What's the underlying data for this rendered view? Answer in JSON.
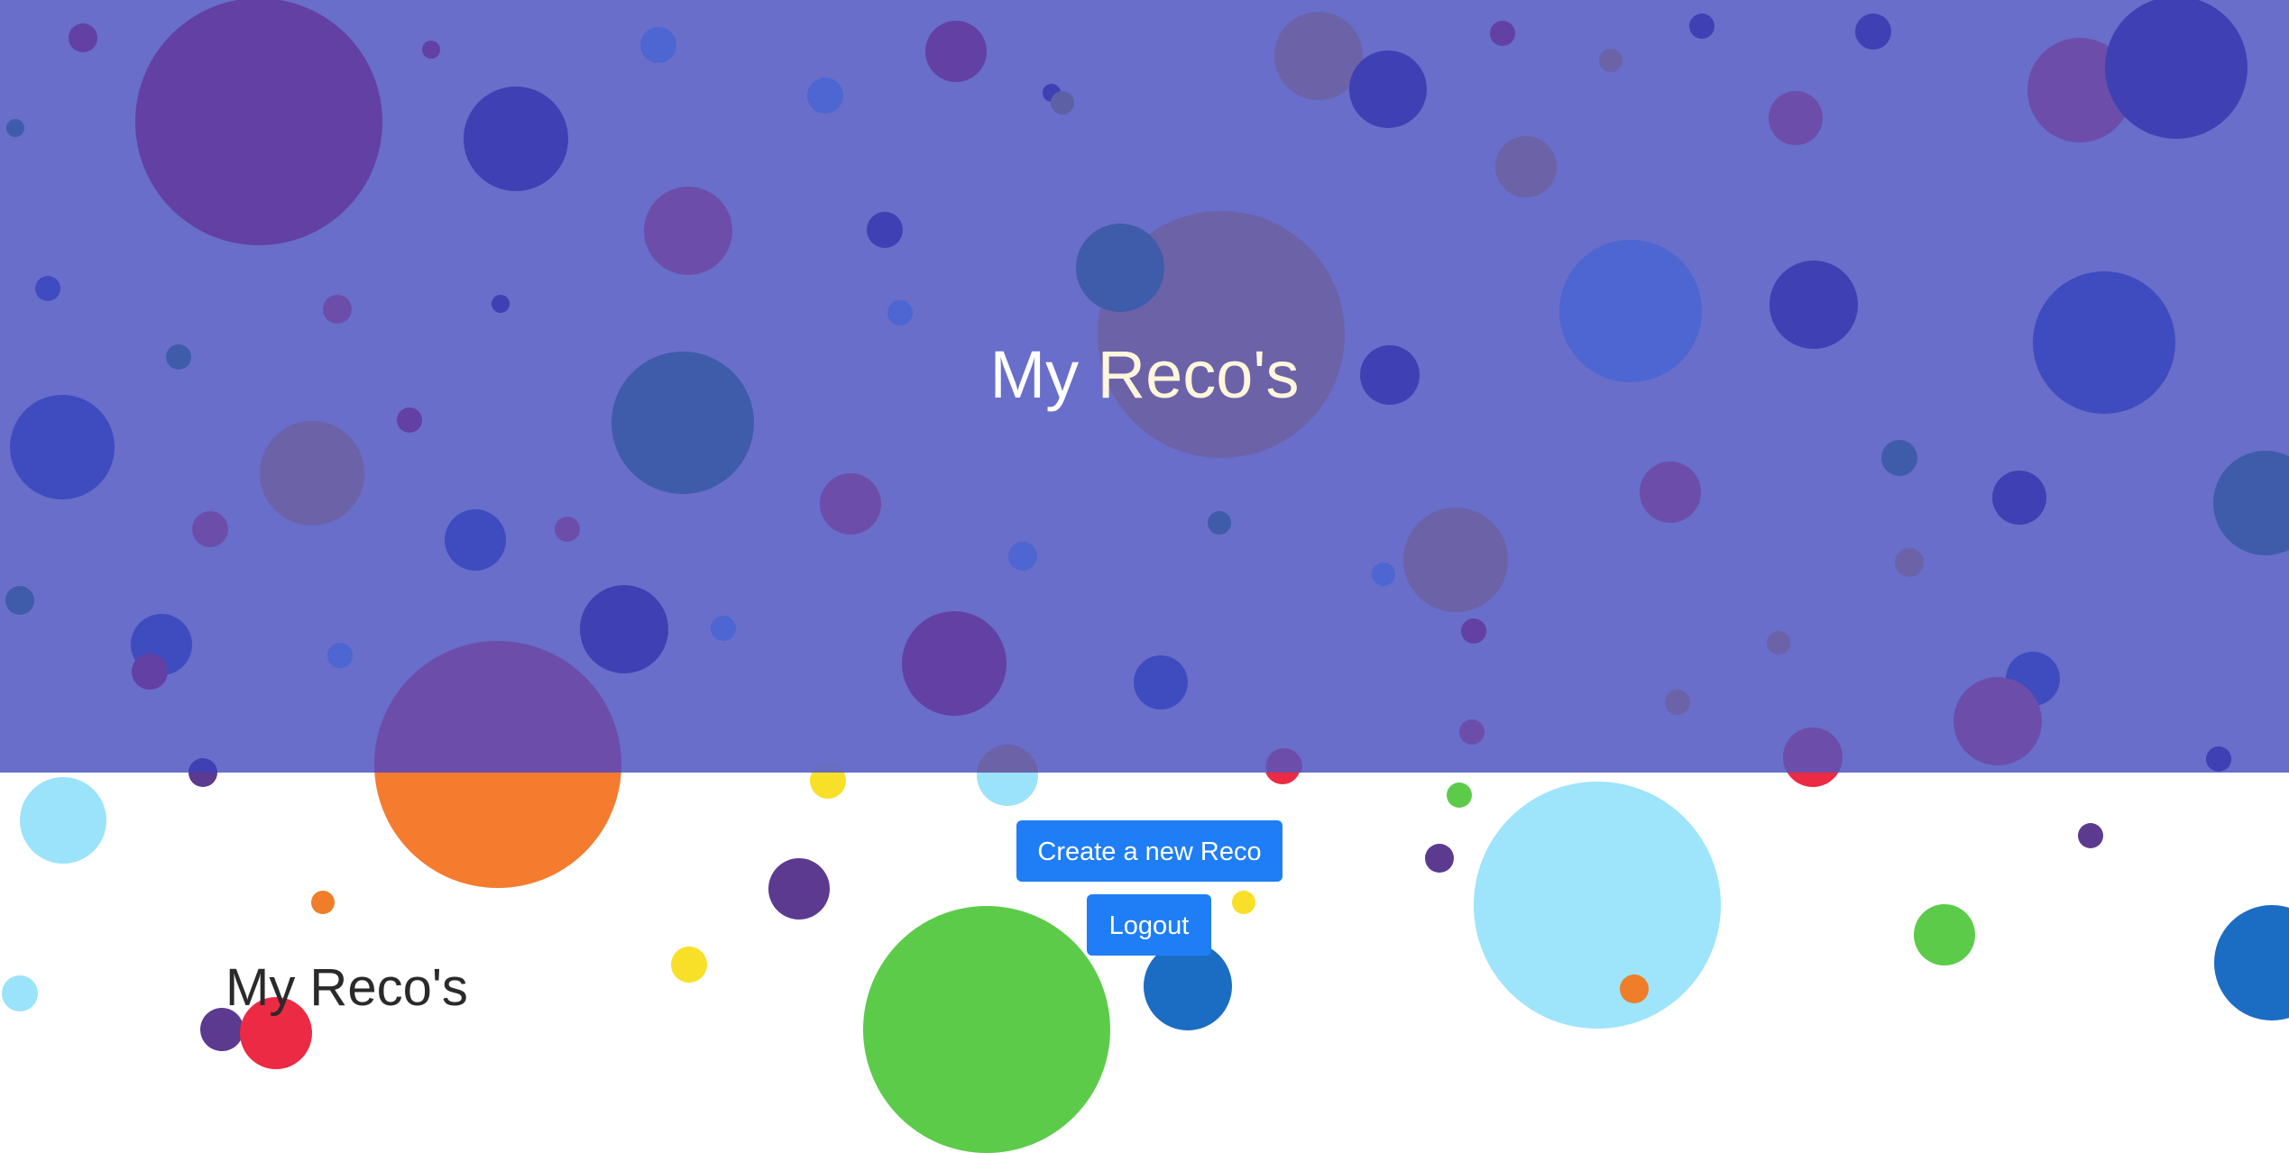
{
  "hero": {
    "title_part1": "My",
    "title_part2": "Reco's"
  },
  "actions": {
    "create_label": "Create a new Reco",
    "logout_label": "Logout"
  },
  "section": {
    "title": "My Reco's"
  },
  "colors": {
    "hero_overlay": "#6268c7",
    "button": "#1f7ef5",
    "title_accent": "#fff6dc"
  }
}
